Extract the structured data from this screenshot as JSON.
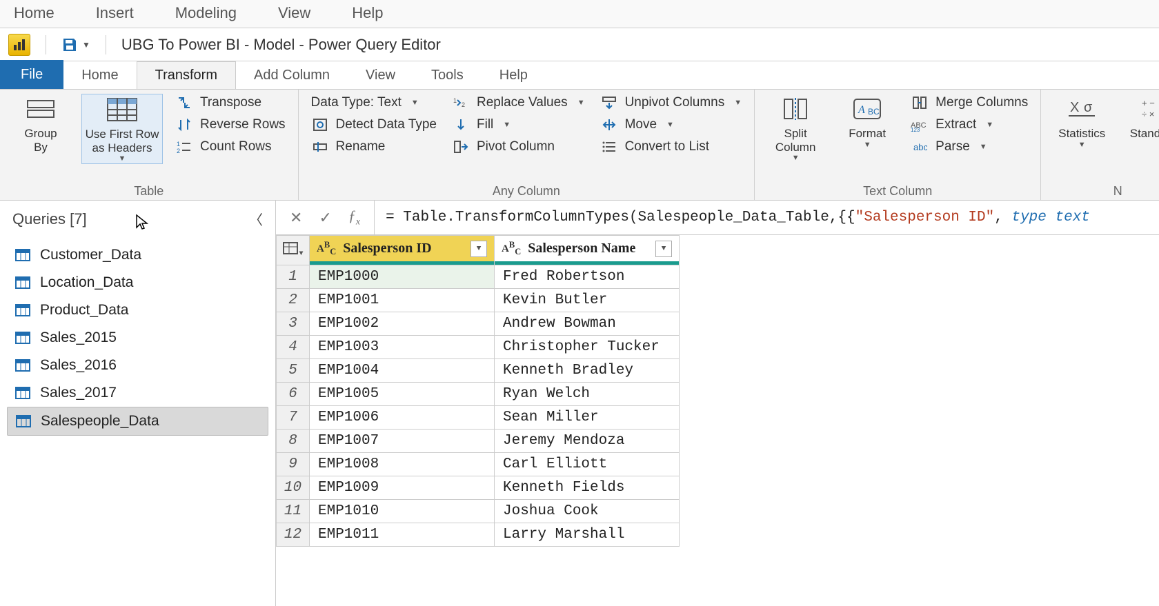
{
  "top_menu": [
    "Home",
    "Insert",
    "Modeling",
    "View",
    "Help"
  ],
  "window_title": "UBG To Power BI - Model - Power Query Editor",
  "ribbon_tabs": {
    "file": "File",
    "items": [
      "Home",
      "Transform",
      "Add Column",
      "View",
      "Tools",
      "Help"
    ],
    "active": "Transform"
  },
  "ribbon": {
    "table_group": {
      "label": "Table",
      "group_by": "Group\nBy",
      "use_first_row": "Use First Row\nas Headers",
      "transpose": "Transpose",
      "reverse_rows": "Reverse Rows",
      "count_rows": "Count Rows"
    },
    "any_column_group": {
      "label": "Any Column",
      "data_type": "Data Type: Text",
      "detect": "Detect Data Type",
      "rename": "Rename",
      "replace_values": "Replace Values",
      "fill": "Fill",
      "pivot": "Pivot Column",
      "unpivot": "Unpivot Columns",
      "move": "Move",
      "to_list": "Convert to List"
    },
    "text_column_group": {
      "label": "Text Column",
      "split": "Split\nColumn",
      "format": "Format",
      "merge": "Merge Columns",
      "extract": "Extract",
      "parse": "Parse"
    },
    "number_group": {
      "label": "N",
      "statistics": "Statistics",
      "standard": "Standard"
    }
  },
  "queries": {
    "header": "Queries [7]",
    "items": [
      "Customer_Data",
      "Location_Data",
      "Product_Data",
      "Sales_2015",
      "Sales_2016",
      "Sales_2017",
      "Salespeople_Data"
    ],
    "selected": "Salespeople_Data"
  },
  "formula": {
    "prefix": "= Table.TransformColumnTypes(Salespeople_Data_Table,{{",
    "str": "\"Salesperson ID\"",
    "mid": ", ",
    "type_kw": "type",
    "type_name": "text"
  },
  "columns": [
    {
      "name": "Salesperson ID",
      "selected": true
    },
    {
      "name": "Salesperson Name",
      "selected": false
    }
  ],
  "rows": [
    {
      "n": "1",
      "c0": "EMP1000",
      "c1": "Fred Robertson"
    },
    {
      "n": "2",
      "c0": "EMP1001",
      "c1": "Kevin Butler"
    },
    {
      "n": "3",
      "c0": "EMP1002",
      "c1": "Andrew Bowman"
    },
    {
      "n": "4",
      "c0": "EMP1003",
      "c1": "Christopher Tucker"
    },
    {
      "n": "5",
      "c0": "EMP1004",
      "c1": "Kenneth Bradley"
    },
    {
      "n": "6",
      "c0": "EMP1005",
      "c1": "Ryan Welch"
    },
    {
      "n": "7",
      "c0": "EMP1006",
      "c1": "Sean Miller"
    },
    {
      "n": "8",
      "c0": "EMP1007",
      "c1": "Jeremy Mendoza"
    },
    {
      "n": "9",
      "c0": "EMP1008",
      "c1": "Carl Elliott"
    },
    {
      "n": "10",
      "c0": "EMP1009",
      "c1": "Kenneth Fields"
    },
    {
      "n": "11",
      "c0": "EMP1010",
      "c1": "Joshua Cook"
    },
    {
      "n": "12",
      "c0": "EMP1011",
      "c1": "Larry Marshall"
    }
  ]
}
